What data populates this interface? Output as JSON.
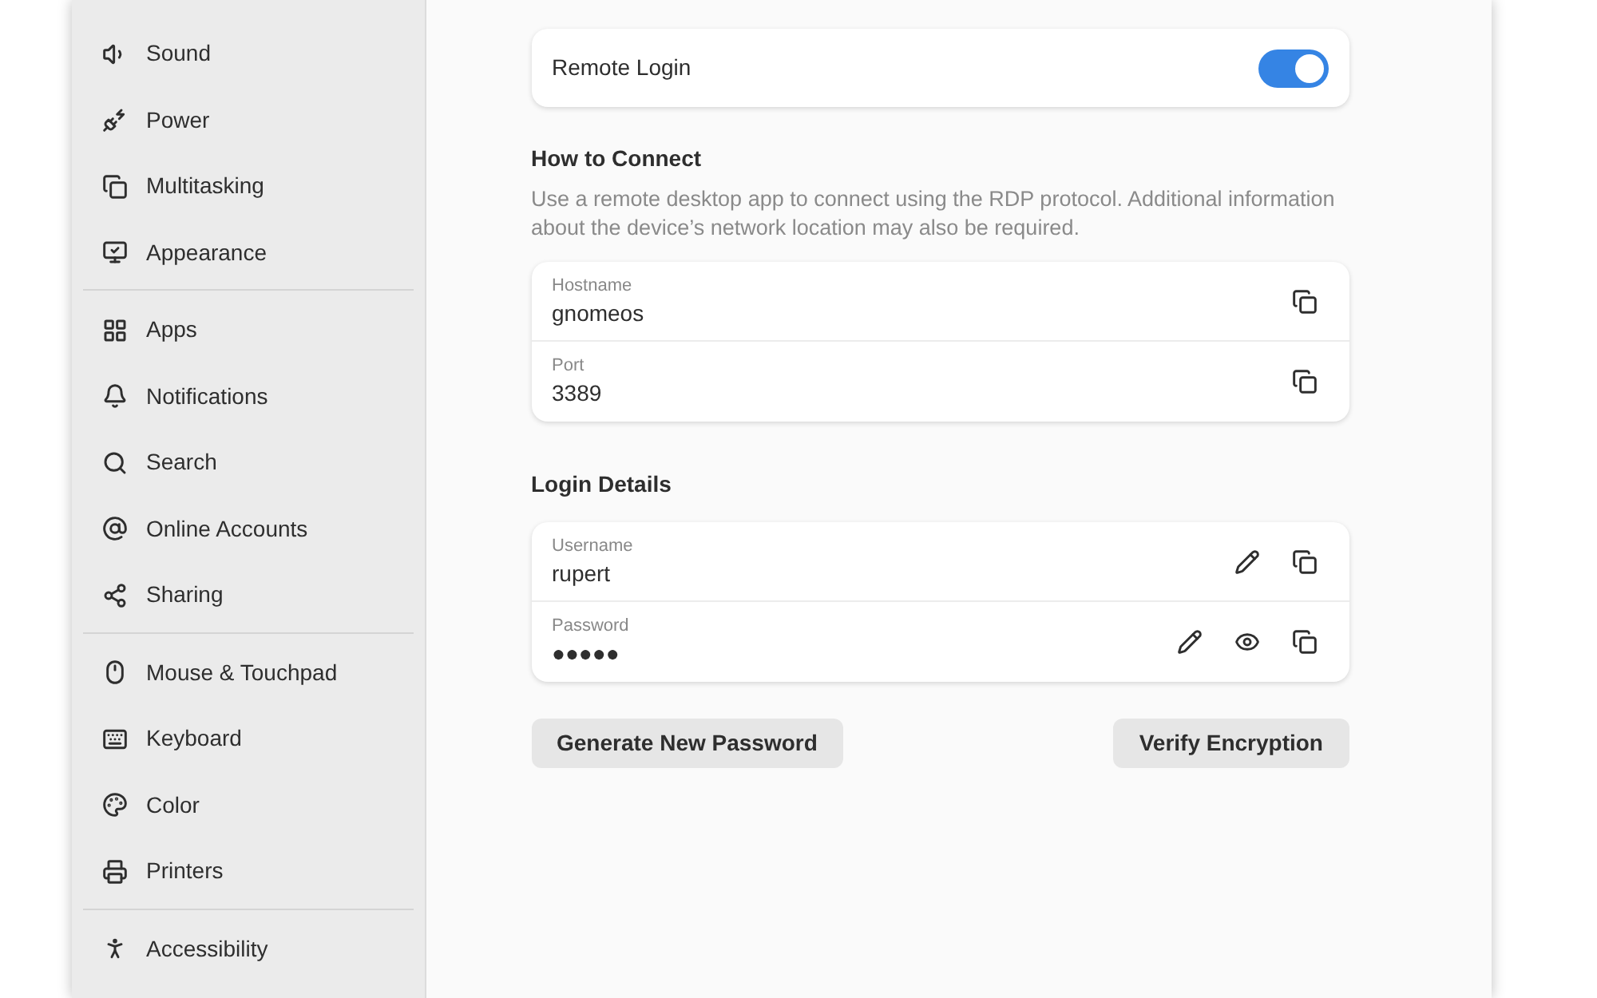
{
  "sidebar": {
    "groups": [
      {
        "items": [
          {
            "label": "Sound"
          },
          {
            "label": "Power"
          },
          {
            "label": "Multitasking"
          },
          {
            "label": "Appearance"
          }
        ]
      },
      {
        "items": [
          {
            "label": "Apps"
          },
          {
            "label": "Notifications"
          },
          {
            "label": "Search"
          },
          {
            "label": "Online Accounts"
          },
          {
            "label": "Sharing"
          }
        ]
      },
      {
        "items": [
          {
            "label": "Mouse & Touchpad"
          },
          {
            "label": "Keyboard"
          },
          {
            "label": "Color"
          },
          {
            "label": "Printers"
          }
        ]
      },
      {
        "items": [
          {
            "label": "Accessibility"
          }
        ]
      }
    ]
  },
  "remote_login": {
    "label": "Remote Login",
    "on": true
  },
  "how_to_connect": {
    "heading": "How to Connect",
    "description": "Use a remote desktop app to connect using the RDP protocol. Additional information about the device’s network location may also be required.",
    "rows": [
      {
        "kind": "copy",
        "label": "Hostname",
        "value": "gnomeos"
      },
      {
        "kind": "copy",
        "label": "Port",
        "value": "3389"
      }
    ]
  },
  "login_details": {
    "heading": "Login Details",
    "rows": [
      {
        "kind": "editable",
        "label": "Username",
        "value": "rupert"
      },
      {
        "kind": "secret",
        "label": "Password",
        "value": "●●●●●"
      }
    ]
  },
  "buttons": [
    "Generate New Password",
    "Verify Encryption"
  ]
}
